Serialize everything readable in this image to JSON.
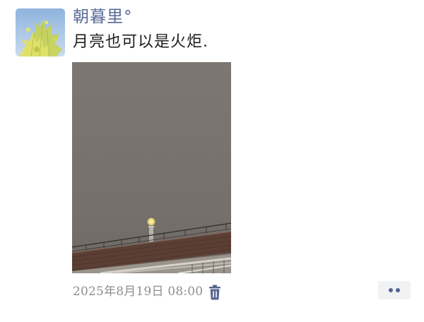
{
  "post": {
    "author": {
      "name": "朝暮里°"
    },
    "text": "月亮也可以是火炬.",
    "photo": {
      "alt_subject": "moon-over-rooftop-photo"
    },
    "timestamp": "2025年8月19日 08:00",
    "icons": {
      "delete": "trash-icon",
      "more": "more-dots-icon"
    }
  },
  "colors": {
    "author_name": "#5a6a96",
    "body_text": "#1d1d1d",
    "timestamp": "#8e8e8e",
    "icon_accent": "#55648e",
    "more_button_bg": "#f1f2f4"
  }
}
